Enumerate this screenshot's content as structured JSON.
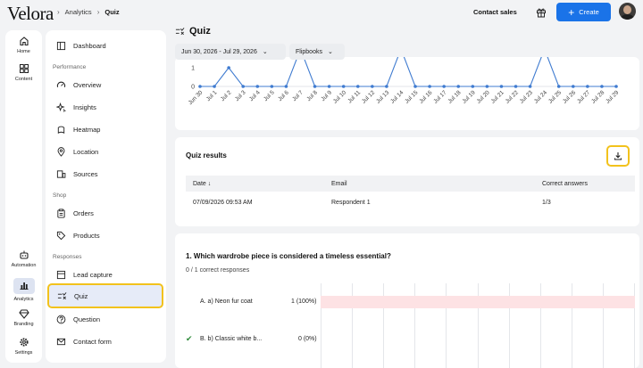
{
  "brand": "Velora",
  "breadcrumb": [
    "Analytics",
    "Quiz"
  ],
  "header": {
    "contact": "Contact sales",
    "create": "Create"
  },
  "rail": [
    "Home",
    "Content",
    "Automation",
    "Analytics",
    "Branding",
    "Settings"
  ],
  "sidebar": {
    "dashboard": "Dashboard",
    "performance_heading": "Performance",
    "performance": [
      "Overview",
      "Insights",
      "Heatmap",
      "Location",
      "Sources"
    ],
    "shop_heading": "Shop",
    "shop": [
      "Orders",
      "Products"
    ],
    "responses_heading": "Responses",
    "responses": [
      "Lead capture",
      "Quiz",
      "Question",
      "Contact form"
    ]
  },
  "page": {
    "title": "Quiz",
    "date_range": "Jun 30, 2026 - Jul 29, 2026",
    "content_filter": "Flipbooks"
  },
  "chart_data": {
    "type": "line",
    "x": [
      "Jun 30",
      "Jul 1",
      "Jul 2",
      "Jul 3",
      "Jul 4",
      "Jul 5",
      "Jul 6",
      "Jul 7",
      "Jul 8",
      "Jul 9",
      "Jul 10",
      "Jul 11",
      "Jul 12",
      "Jul 13",
      "Jul 14",
      "Jul 15",
      "Jul 16",
      "Jul 17",
      "Jul 18",
      "Jul 19",
      "Jul 20",
      "Jul 21",
      "Jul 22",
      "Jul 23",
      "Jul 24",
      "Jul 25",
      "Jul 26",
      "Jul 27",
      "Jul 28",
      "Jul 29"
    ],
    "values": [
      0,
      0,
      1,
      0,
      0,
      0,
      0,
      2,
      0,
      0,
      0,
      0,
      0,
      0,
      2,
      0,
      0,
      0,
      0,
      0,
      0,
      0,
      0,
      0,
      2,
      0,
      0,
      0,
      0,
      0
    ],
    "yticks": [
      "0",
      "1"
    ],
    "ylim": [
      0,
      1.55
    ],
    "color": "#3f7bd0"
  },
  "results": {
    "title": "Quiz results",
    "columns": [
      "Date",
      "Email",
      "Correct answers"
    ],
    "rows": [
      [
        "07/09/2026 09:53 AM",
        "Respondent 1",
        "1/3"
      ]
    ]
  },
  "question": {
    "title": "1. Which wardrobe piece is considered a timeless essential?",
    "subtitle": "0 / 1 correct responses",
    "answers": [
      {
        "label": "A. a) Neon fur coat",
        "count": "1 (100%)",
        "correct": false,
        "share": 1.0
      },
      {
        "label": "B. b) Classic white b...",
        "count": "0 (0%)",
        "correct": true,
        "share": 0.0
      }
    ],
    "bar_color": "#fde2e4"
  },
  "colors": {
    "accent": "#1a73e8",
    "highlight": "#f2c21c",
    "active_bg": "#e6ebf8"
  }
}
